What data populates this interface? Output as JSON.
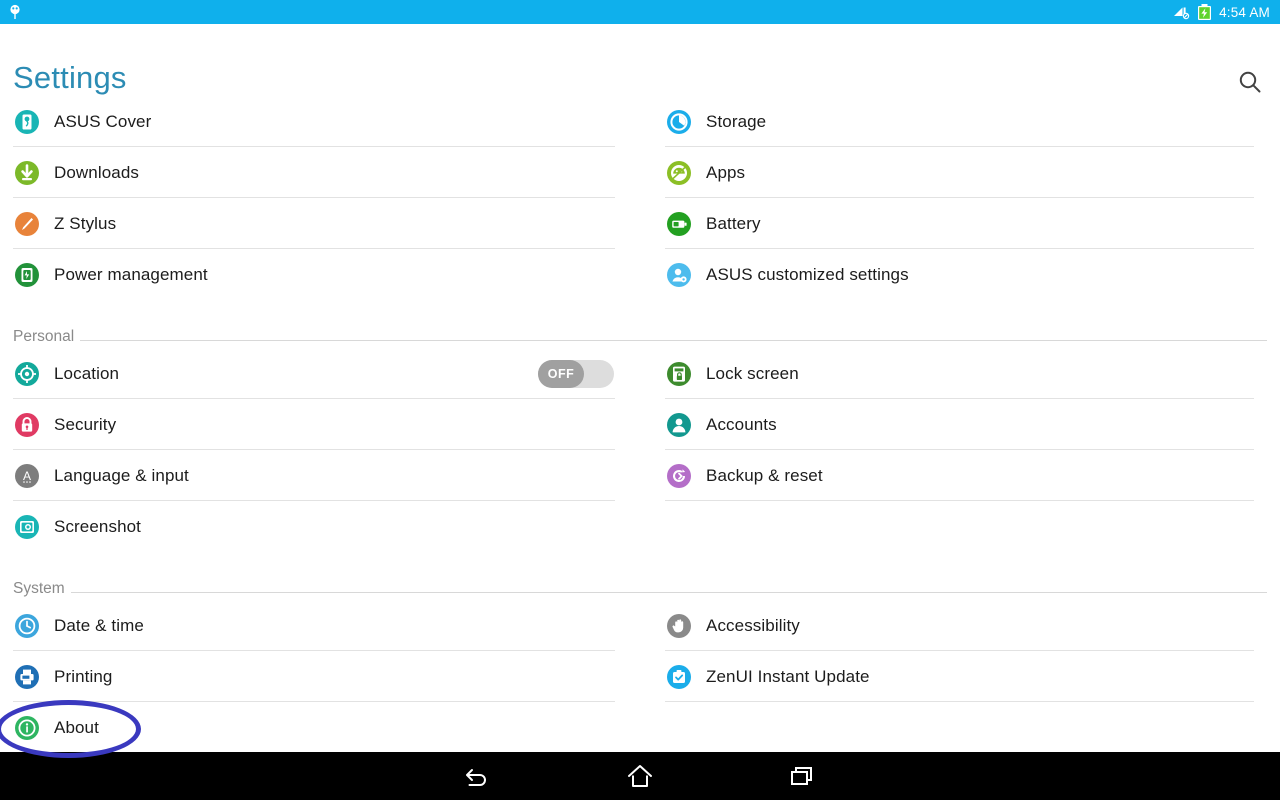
{
  "status_bar": {
    "background": "#0fb0ec",
    "notification_icon": "usb-plug-icon",
    "data_off_icon": "mobile-data-off-icon",
    "battery_icon": "battery-charging-icon",
    "time": "4:54 AM"
  },
  "header": {
    "title": "Settings",
    "title_color": "#2c8cb4",
    "search_icon": "search-icon"
  },
  "sections": [
    {
      "id": "top",
      "label": "",
      "left_items": [
        {
          "label": "ASUS Cover",
          "icon": "asus-cover-icon",
          "color": "#19b5b5"
        },
        {
          "label": "Downloads",
          "icon": "download-arrow-icon",
          "color": "#7cb929"
        },
        {
          "label": "Z Stylus",
          "icon": "stylus-pen-icon",
          "color": "#e8833a"
        },
        {
          "label": "Power management",
          "icon": "power-management-icon",
          "color": "#22923a"
        }
      ],
      "right_items": [
        {
          "label": "Storage",
          "icon": "storage-disc-icon",
          "color": "#1badea"
        },
        {
          "label": "Apps",
          "icon": "android-apps-icon",
          "color": "#8cbf26"
        },
        {
          "label": "Battery",
          "icon": "battery-icon",
          "color": "#23a021"
        },
        {
          "label": "ASUS customized settings",
          "icon": "person-settings-icon",
          "color": "#4dbced"
        }
      ]
    },
    {
      "id": "personal",
      "label": "Personal",
      "left_items": [
        {
          "label": "Location",
          "icon": "location-crosshair-icon",
          "color": "#13a99b",
          "toggle": "OFF"
        },
        {
          "label": "Security",
          "icon": "lock-icon",
          "color": "#e03a63"
        },
        {
          "label": "Language & input",
          "icon": "language-letter-a-icon",
          "color": "#7d7d7d"
        },
        {
          "label": "Screenshot",
          "icon": "screenshot-camera-icon",
          "color": "#19b5b5"
        }
      ],
      "right_items": [
        {
          "label": "Lock screen",
          "icon": "lock-screen-icon",
          "color": "#3d8b2e"
        },
        {
          "label": "Accounts",
          "icon": "account-person-icon",
          "color": "#12988f"
        },
        {
          "label": "Backup & reset",
          "icon": "backup-reset-icon",
          "color": "#b46ec8"
        }
      ]
    },
    {
      "id": "system",
      "label": "System",
      "left_items": [
        {
          "label": "Date & time",
          "icon": "clock-icon",
          "color": "#3ca6dd"
        },
        {
          "label": "Printing",
          "icon": "printer-icon",
          "color": "#1f6fb5"
        },
        {
          "label": "About",
          "icon": "info-circle-icon",
          "color": "#2eb561",
          "annotated": true
        }
      ],
      "right_items": [
        {
          "label": "Accessibility",
          "icon": "accessibility-hand-icon",
          "color": "#8a8a8a"
        },
        {
          "label": "ZenUI Instant Update",
          "icon": "zenui-update-icon",
          "color": "#1badea"
        }
      ]
    }
  ],
  "toggle": {
    "off_label": "OFF",
    "track_color": "#dddddd",
    "knob_color": "#a0a0a0"
  },
  "annotation": {
    "shape": "ellipse",
    "color": "#3a39bf",
    "target": "About"
  },
  "nav_bar": {
    "back_icon": "back-arrow-icon",
    "home_icon": "home-icon",
    "recents_icon": "recent-apps-icon"
  }
}
